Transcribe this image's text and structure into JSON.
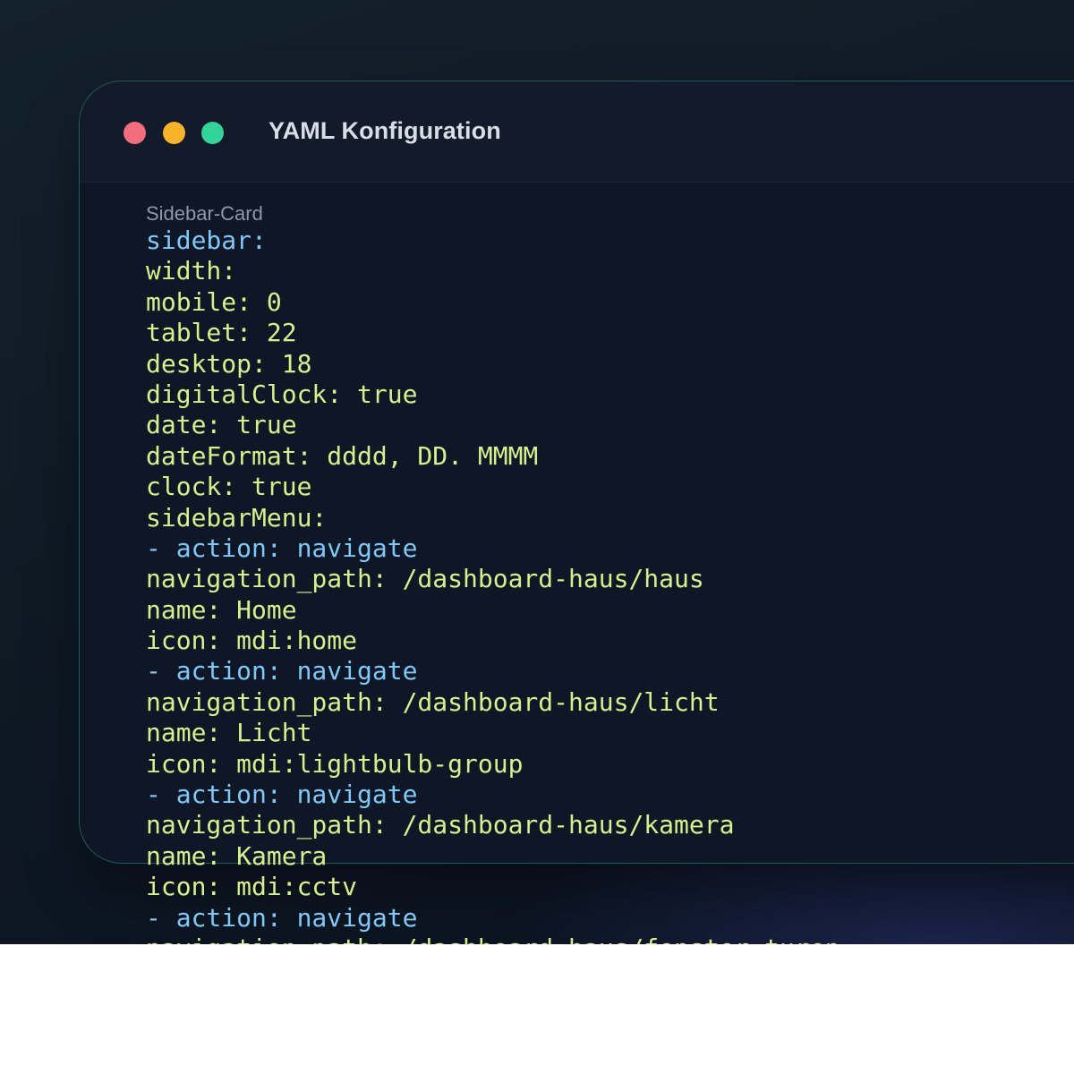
{
  "window": {
    "title": "YAML Konfiguration"
  },
  "editor": {
    "file_label": "Sidebar-Card",
    "lines": [
      "sidebar:",
      "width:",
      "mobile: 0",
      "tablet: 22",
      "desktop: 18",
      "digitalClock: true",
      "date: true",
      "dateFormat: dddd, DD. MMMM",
      "clock: true",
      "sidebarMenu:",
      "action: navigate",
      "navigation_path: /dashboard-haus/haus",
      "name: Home",
      "icon: mdi:home",
      "action: navigate",
      "navigation_path: /dashboard-haus/licht",
      "name: Licht",
      "icon: mdi:lightbulb-group",
      "action: navigate",
      "navigation_path: /dashboard-haus/kamera",
      "name: Kamera",
      "icon: mdi:cctv",
      "action: navigate",
      "navigation_path: /dashboard-haus/fenster-turen"
    ],
    "list_marker": "- "
  },
  "colors": {
    "key_blue": "#7fc8f8",
    "value_green": "#d6ef8f",
    "dot_red": "#f26d7d",
    "dot_yellow": "#f7b32b",
    "dot_green": "#34d399"
  }
}
